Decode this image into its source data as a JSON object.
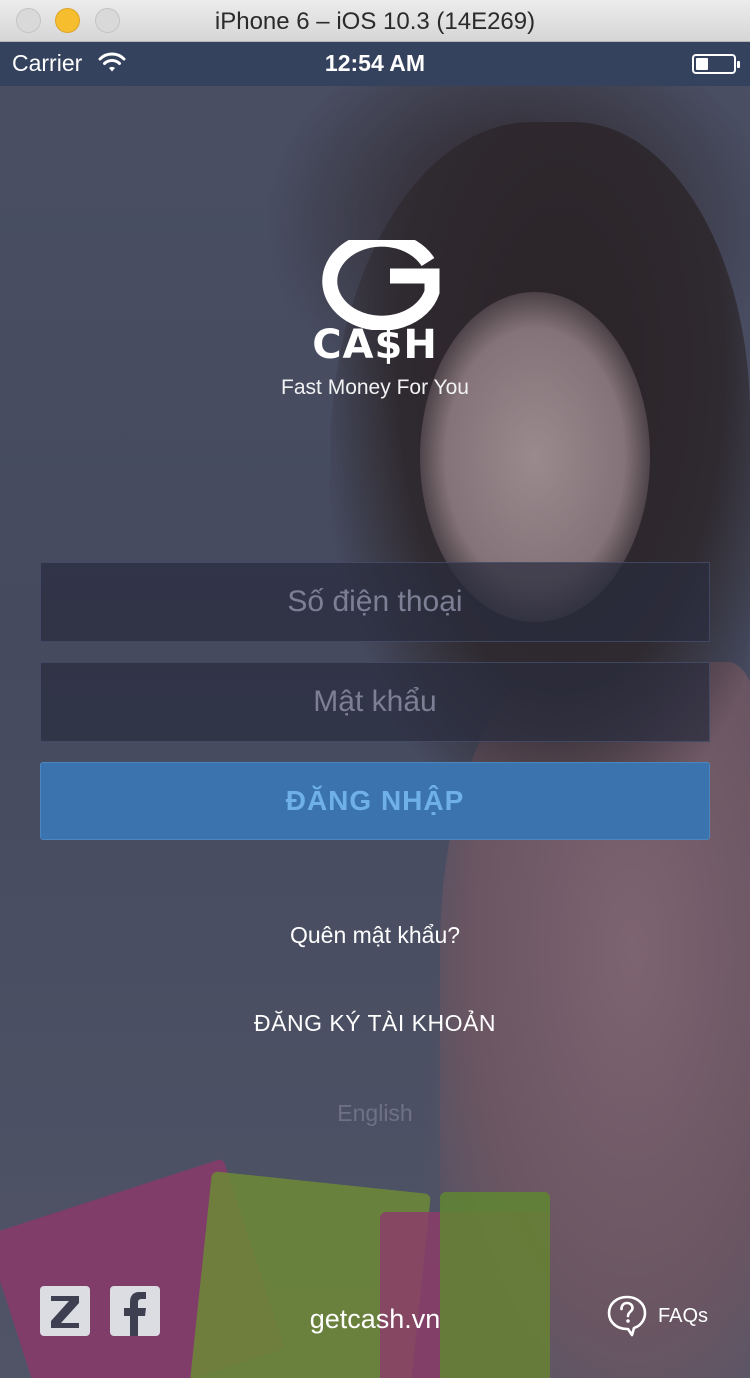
{
  "window": {
    "title": "iPhone 6 – iOS 10.3 (14E269)"
  },
  "statusbar": {
    "carrier": "Carrier",
    "time": "12:54 AM"
  },
  "brand": {
    "logo_text": "CA$H",
    "tagline": "Fast Money For You"
  },
  "form": {
    "phone_placeholder": "Số điện thoại",
    "phone_value": "",
    "password_placeholder": "Mật khẩu",
    "password_value": "",
    "login_label": "ĐĂNG NHẬP"
  },
  "links": {
    "forgot": "Quên mật khẩu?",
    "register": "ĐĂNG KÝ TÀI KHOẢN",
    "language": "English"
  },
  "footer": {
    "website": "getcash.vn",
    "faq": "FAQs"
  },
  "icons": [
    "wifi-icon",
    "battery-icon",
    "zalo-icon",
    "facebook-icon",
    "faq-icon"
  ],
  "colors": {
    "accent": "#3a73ad",
    "accent_text": "#6fb0ea",
    "statusbar": "#35425e"
  }
}
